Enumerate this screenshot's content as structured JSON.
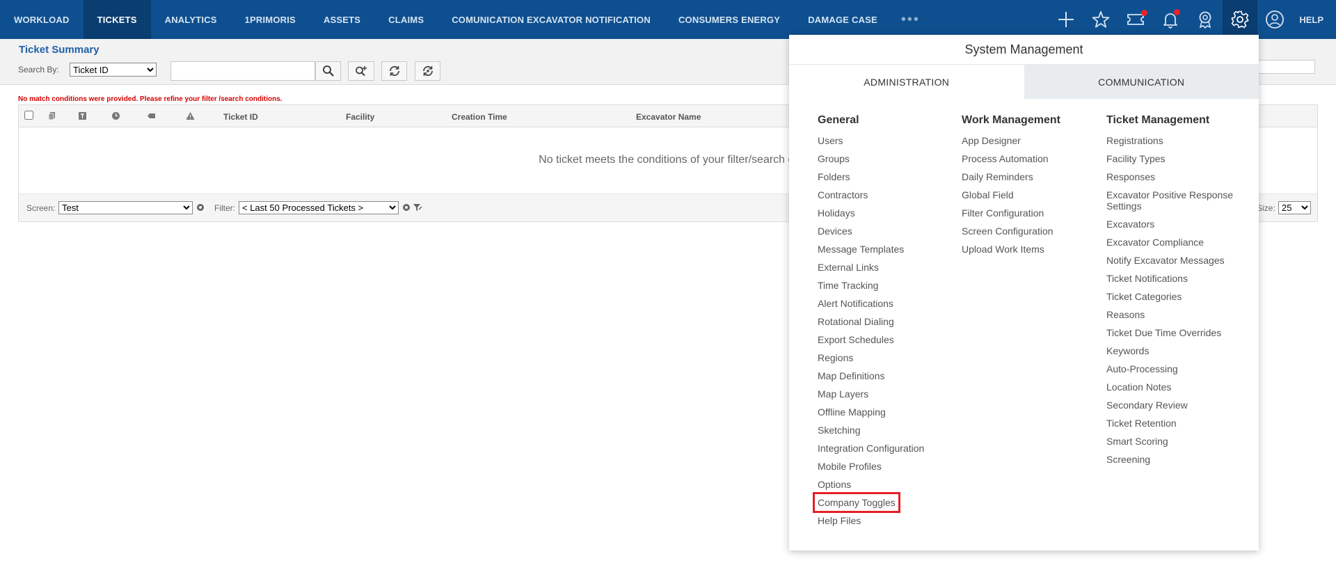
{
  "nav": {
    "items": [
      "WORKLOAD",
      "TICKETS",
      "ANALYTICS",
      "1PRIMORIS",
      "ASSETS",
      "CLAIMS",
      "COMUNICATION EXCAVATOR NOTIFICATION",
      "CONSUMERS ENERGY",
      "DAMAGE CASE"
    ],
    "active": "TICKETS",
    "more": "•••",
    "help": "HELP",
    "icons": [
      "plus-icon",
      "star-icon",
      "ticket-icon",
      "bell-icon",
      "award-icon",
      "gear-icon",
      "user-icon"
    ]
  },
  "summary": {
    "title": "Ticket Summary",
    "search_label": "Search By:",
    "search_by_value": "Ticket ID",
    "search_value": ""
  },
  "error": "No match conditions were provided. Please refine your filter /search conditions.",
  "grid": {
    "columns": [
      "Ticket ID",
      "Facility",
      "Creation Time",
      "Excavator Name"
    ],
    "empty_message": "No ticket meets the conditions of your filter/search cr",
    "screen_label": "Screen:",
    "screen_value": "Test",
    "filter_label": "Filter:",
    "filter_value": "< Last 50 Processed Tickets >",
    "size_label": "Size:",
    "size_value": "25"
  },
  "system_management": {
    "title": "System Management",
    "tabs": [
      "ADMINISTRATION",
      "COMMUNICATION"
    ],
    "active_tab": "ADMINISTRATION",
    "columns": [
      {
        "heading": "General",
        "links": [
          "Users",
          "Groups",
          "Folders",
          "Contractors",
          "Holidays",
          "Devices",
          "Message Templates",
          "External Links",
          "Time Tracking",
          "Alert Notifications",
          "Rotational Dialing",
          "Export Schedules",
          "Regions",
          "Map Definitions",
          "Map Layers",
          "Offline Mapping",
          "Sketching",
          "Integration Configuration",
          "Mobile Profiles",
          "Options",
          "Company Toggles",
          "Help Files"
        ]
      },
      {
        "heading": "Work Management",
        "links": [
          "App Designer",
          "Process Automation",
          "Daily Reminders",
          "Global Field",
          "Filter Configuration",
          "Screen Configuration",
          "Upload Work Items"
        ]
      },
      {
        "heading": "Ticket Management",
        "links": [
          "Registrations",
          "Facility Types",
          "Responses",
          "Excavator Positive Response Settings",
          "Excavators",
          "Excavator Compliance",
          "Notify Excavator Messages",
          "Ticket Notifications",
          "Ticket Categories",
          "Reasons",
          "Ticket Due Time Overrides",
          "Keywords",
          "Auto-Processing",
          "Location Notes",
          "Secondary Review",
          "Ticket Retention",
          "Smart Scoring",
          "Screening"
        ]
      }
    ],
    "highlighted_link": "Company Toggles"
  }
}
